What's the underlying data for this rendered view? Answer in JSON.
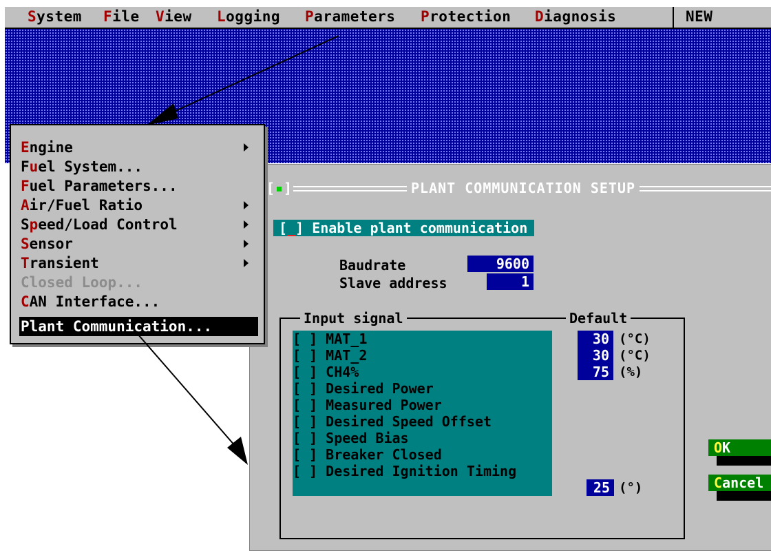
{
  "menubar": {
    "items": [
      {
        "hotkey": "S",
        "rest": "ystem"
      },
      {
        "hotkey": "F",
        "rest": "ile"
      },
      {
        "hotkey": "V",
        "rest": "iew"
      },
      {
        "hotkey": "L",
        "rest": "ogging"
      },
      {
        "hotkey": "P",
        "rest": "arameters"
      },
      {
        "hotkey": "P",
        "rest": "rotection"
      },
      {
        "hotkey": "D",
        "rest": "iagnosis"
      }
    ],
    "status": "NEW"
  },
  "dropdown": {
    "items": [
      {
        "hotkey": "E",
        "rest": "ngine",
        "submenu": true,
        "disabled": false
      },
      {
        "pre": "F",
        "hotkey": "u",
        "rest": "el System...",
        "submenu": false,
        "disabled": false
      },
      {
        "hotkey": "F",
        "rest": "uel Parameters...",
        "submenu": false,
        "disabled": false
      },
      {
        "hotkey": "A",
        "rest": "ir/Fuel Ratio",
        "submenu": true,
        "disabled": false
      },
      {
        "pre": "S",
        "hotkey": "p",
        "rest": "eed/Load Control",
        "submenu": true,
        "disabled": false
      },
      {
        "hotkey": "S",
        "rest": "ensor",
        "submenu": true,
        "disabled": false
      },
      {
        "hotkey": "T",
        "rest": "ransient",
        "submenu": true,
        "disabled": false
      },
      {
        "label": "Closed Loop...",
        "submenu": false,
        "disabled": true
      },
      {
        "hotkey": "C",
        "rest": "AN Interface...",
        "submenu": false,
        "disabled": false
      },
      {
        "label": "Plant Communication...",
        "submenu": false,
        "selected": true
      }
    ]
  },
  "dialog": {
    "close_box": "[ ]",
    "title": "PLANT COMMUNICATION SETUP",
    "enable_checkbox": "[ ]",
    "enable_label": "Enable plant communication",
    "baudrate_label": "Baudrate",
    "baudrate_value": "9600",
    "slave_label": "Slave address",
    "slave_value": "1",
    "group_input_label": "Input signal",
    "group_default_label": "Default",
    "signals": [
      {
        "check": "[ ]",
        "name": "MAT_1",
        "default": "30",
        "unit": "(°C)"
      },
      {
        "check": "[ ]",
        "name": "MAT_2",
        "default": "30",
        "unit": "(°C)"
      },
      {
        "check": "[ ]",
        "name": "CH4%",
        "default": "75",
        "unit": "(%)"
      },
      {
        "check": "[ ]",
        "name": "Desired Power"
      },
      {
        "check": "[ ]",
        "name": "Measured Power"
      },
      {
        "check": "[ ]",
        "name": "Desired Speed Offset"
      },
      {
        "check": "[ ]",
        "name": "Speed Bias"
      },
      {
        "check": "[ ]",
        "name": "Breaker Closed"
      },
      {
        "check": "[ ]",
        "name": "Desired Ignition Timing",
        "default": "25",
        "unit": "(°)"
      }
    ],
    "ok_hotkey": "O",
    "ok_rest": "K",
    "cancel_hotkey": "C",
    "cancel_rest": "ancel"
  },
  "colors": {
    "menubar_bg": "#c0c0c0",
    "desktop_bg": "#00009a",
    "hotkey": "#a00000",
    "teal": "#008080",
    "button": "#008000"
  }
}
